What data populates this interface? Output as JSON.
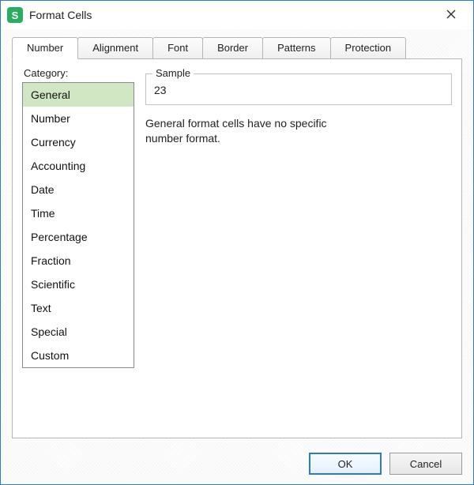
{
  "window": {
    "title": "Format Cells",
    "app_icon_letter": "S"
  },
  "tabs": [
    {
      "label": "Number",
      "active": true
    },
    {
      "label": "Alignment",
      "active": false
    },
    {
      "label": "Font",
      "active": false
    },
    {
      "label": "Border",
      "active": false
    },
    {
      "label": "Patterns",
      "active": false
    },
    {
      "label": "Protection",
      "active": false
    }
  ],
  "number_tab": {
    "category_label": "Category:",
    "categories": [
      {
        "label": "General",
        "selected": true
      },
      {
        "label": "Number",
        "selected": false
      },
      {
        "label": "Currency",
        "selected": false
      },
      {
        "label": "Accounting",
        "selected": false
      },
      {
        "label": "Date",
        "selected": false
      },
      {
        "label": "Time",
        "selected": false
      },
      {
        "label": "Percentage",
        "selected": false
      },
      {
        "label": "Fraction",
        "selected": false
      },
      {
        "label": "Scientific",
        "selected": false
      },
      {
        "label": "Text",
        "selected": false
      },
      {
        "label": "Special",
        "selected": false
      },
      {
        "label": "Custom",
        "selected": false
      }
    ],
    "sample_label": "Sample",
    "sample_value": "23",
    "description": "General format cells have no specific number format."
  },
  "buttons": {
    "ok": "OK",
    "cancel": "Cancel"
  }
}
